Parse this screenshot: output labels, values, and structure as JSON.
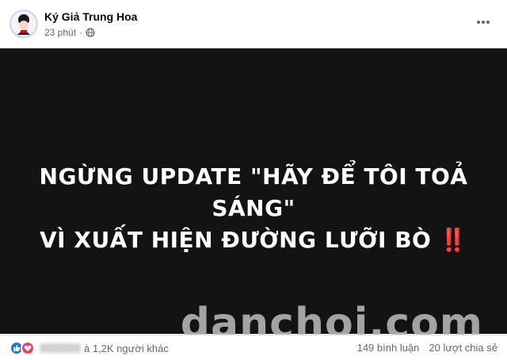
{
  "post": {
    "author": "Ký Giả Trung Hoa",
    "time": "23 phút",
    "visibility_icon": "globe-icon",
    "more_icon": "more-dots-icon"
  },
  "media": {
    "line1": "NGỪNG UPDATE \"HÃY ĐỂ TÔI TOẢ SÁNG\"",
    "line2": "VÌ XUẤT HIỆN ĐƯỜNG LƯỠI BÒ",
    "emoji": "‼️",
    "watermark": "danchoi.com"
  },
  "footer": {
    "reaction_text": "à 1,2K người khác",
    "comments": "149 bình luận",
    "shares": "20 lượt chia sẻ"
  },
  "colors": {
    "like": "#1877f2",
    "love": "#f33e58",
    "media_bg": "#131313"
  }
}
